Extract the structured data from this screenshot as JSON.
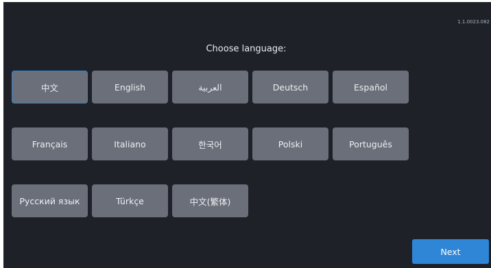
{
  "version": "1.1.0023.082",
  "title": "Choose language:",
  "selected_language": "中文",
  "languages": [
    "中文",
    "English",
    "العربية",
    "Deutsch",
    "Español",
    "Français",
    "Italiano",
    "한국어",
    "Polski",
    "Português",
    "Русский язык",
    "Türkçe",
    "中文(繁体)"
  ],
  "next_label": "Next",
  "colors": {
    "background": "#1e2228",
    "button": "#6a6f79",
    "accent": "#2f86d6",
    "text": "#eef0f3"
  }
}
